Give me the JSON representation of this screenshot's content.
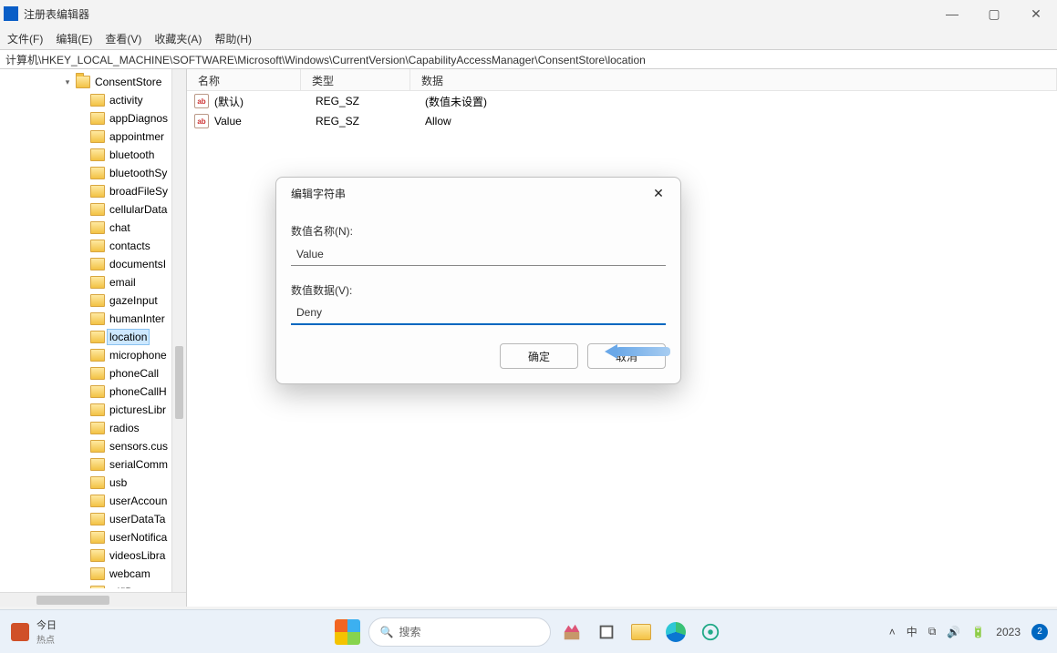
{
  "window": {
    "title": "注册表编辑器"
  },
  "menu": {
    "file": "文件(F)",
    "edit": "编辑(E)",
    "view": "查看(V)",
    "favorites": "收藏夹(A)",
    "help": "帮助(H)"
  },
  "address": "计算机\\HKEY_LOCAL_MACHINE\\SOFTWARE\\Microsoft\\Windows\\CurrentVersion\\CapabilityAccessManager\\ConsentStore\\location",
  "tree": {
    "parent": "ConsentStore",
    "items": [
      "activity",
      "appDiagnostics",
      "appointments",
      "bluetooth",
      "bluetoothSync",
      "broadFileSystemAccess",
      "cellularData",
      "chat",
      "contacts",
      "documentsLibrary",
      "email",
      "gazeInput",
      "humanInterfaceDevice",
      "location",
      "microphone",
      "phoneCall",
      "phoneCallHistory",
      "picturesLibrary",
      "radios",
      "sensors.custom",
      "serialCommunication",
      "usb",
      "userAccountInformation",
      "userDataTasks",
      "userNotificationListener",
      "videosLibrary",
      "webcam",
      "wifiData"
    ],
    "selected": "location"
  },
  "list": {
    "headers": {
      "name": "名称",
      "type": "类型",
      "data": "数据"
    },
    "rows": [
      {
        "name": "(默认)",
        "type": "REG_SZ",
        "data": "(数值未设置)"
      },
      {
        "name": "Value",
        "type": "REG_SZ",
        "data": "Allow"
      }
    ]
  },
  "dialog": {
    "title": "编辑字符串",
    "name_label": "数值名称(N):",
    "name_value": "Value",
    "data_label": "数值数据(V):",
    "data_value": "Deny",
    "ok": "确定",
    "cancel": "取消"
  },
  "taskbar": {
    "widget_l1": "今日",
    "widget_l2": "热点",
    "search_placeholder": "搜索",
    "ime": "中",
    "clock": "2023",
    "notif_count": "2"
  },
  "icons": {
    "minimize": "—",
    "maximize": "▢",
    "close": "✕",
    "chevron": "▾",
    "search": "🔍",
    "caret_up": "˄",
    "wifi": "⧉",
    "speaker": "🔊",
    "battery": "🔋"
  }
}
